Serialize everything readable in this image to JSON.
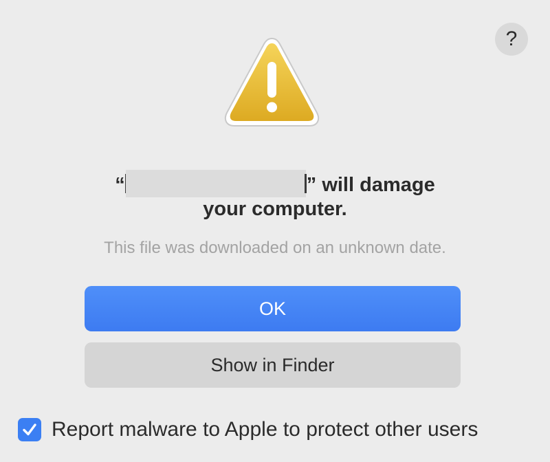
{
  "dialog": {
    "help_label": "?",
    "title_open_quote": "“",
    "title_close_suffix": "” will damage",
    "title_line2": "your computer.",
    "subtitle": "This file was downloaded on an unknown date.",
    "ok_label": "OK",
    "show_in_finder_label": "Show in Finder",
    "report_checkbox_checked": true,
    "report_label": "Report malware to Apple to protect other users"
  },
  "icons": {
    "warning": "warning-icon",
    "help": "help-icon",
    "checkmark": "checkmark-icon"
  },
  "colors": {
    "background": "#ececec",
    "accent": "#3d7bf1",
    "warning_yellow": "#e8b931"
  }
}
